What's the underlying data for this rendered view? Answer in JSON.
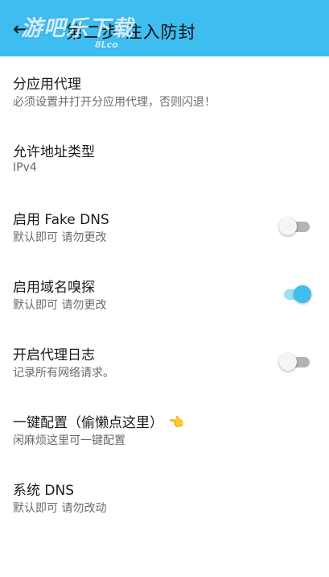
{
  "appbar": {
    "title": "第二步 注入防封",
    "back_icon": "arrow-left-icon",
    "watermark": "游吧乐下载",
    "watermark_sub": "8Lco"
  },
  "settings": [
    {
      "title": "分应用代理",
      "subtitle": "必须设置并打开分应用代理，否则闪退！",
      "toggle": null
    },
    {
      "title": "允许地址类型",
      "subtitle": "IPv4",
      "toggle": null
    },
    {
      "title": "启用 Fake DNS",
      "subtitle": "默认即可 请勿更改",
      "toggle": "off"
    },
    {
      "title": "启用域名嗅探",
      "subtitle": "默认即可 请勿更改",
      "toggle": "on"
    },
    {
      "title": "开启代理日志",
      "subtitle": "记录所有网络请求。",
      "toggle": "off"
    },
    {
      "title": "一键配置（偷懒点这里）",
      "subtitle": "闲麻烦这里可一键配置",
      "toggle": null,
      "emoji": "👈"
    },
    {
      "title": "系统 DNS",
      "subtitle": "默认即可 请勿改动",
      "toggle": null
    }
  ],
  "colors": {
    "accent": "#3dbdf0",
    "switch_on_track": "#9fe0f6",
    "switch_off_track": "#b4b4b4"
  }
}
